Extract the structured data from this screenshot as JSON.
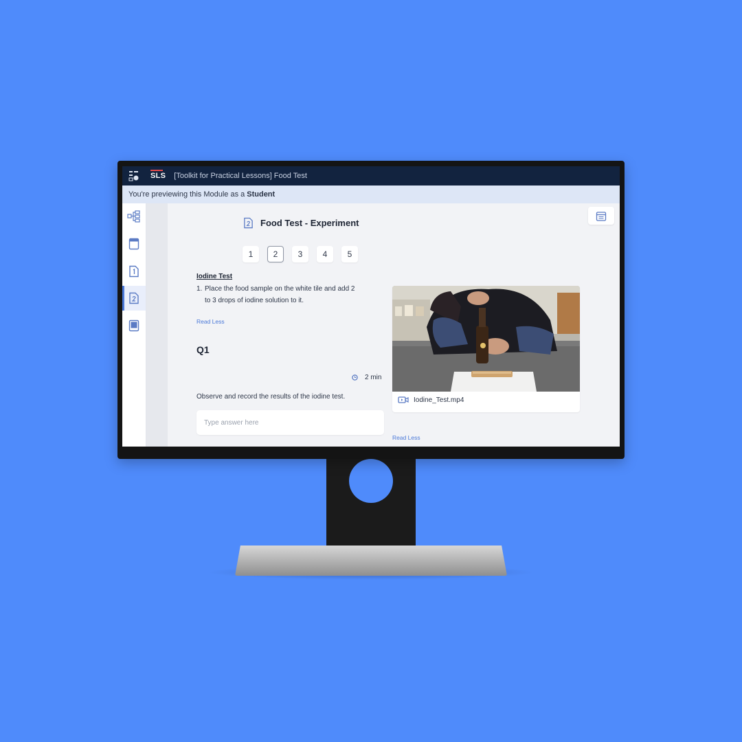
{
  "app": {
    "logo": "SLS",
    "title": "[Toolkit for Practical Lessons] Food Test"
  },
  "banner": {
    "prefix": "You're previewing this Module as a",
    "role": "Student"
  },
  "rail": {
    "items": [
      {
        "icon": "map-tree-icon",
        "active": false
      },
      {
        "icon": "cover-page-icon",
        "active": false
      },
      {
        "icon": "page-1-icon",
        "active": false
      },
      {
        "icon": "page-2-icon",
        "active": true
      },
      {
        "icon": "book-icon",
        "active": false
      }
    ]
  },
  "section": {
    "icon": "page-2-icon",
    "title": "Food Test - Experiment"
  },
  "pager": {
    "pages": [
      "1",
      "2",
      "3",
      "4",
      "5"
    ],
    "current": "2"
  },
  "content": {
    "subtitle": "Iodine Test",
    "step_number": "1.",
    "step_line1": "Place the food sample on the white tile and add 2",
    "step_line2": "to 3 drops of iodine solution to it.",
    "read_less": "Read Less"
  },
  "question": {
    "label": "Q1",
    "time": "2 min",
    "prompt": "Observe and record the results of the iodine test.",
    "answer_placeholder": "Type answer here"
  },
  "video": {
    "filename": "Iodine_Test.mp4",
    "read_less": "Read Less"
  },
  "colors": {
    "background": "#4f8bfb",
    "topbar": "#12233f",
    "banner": "#dde6f6",
    "accent": "#4a78d8"
  }
}
